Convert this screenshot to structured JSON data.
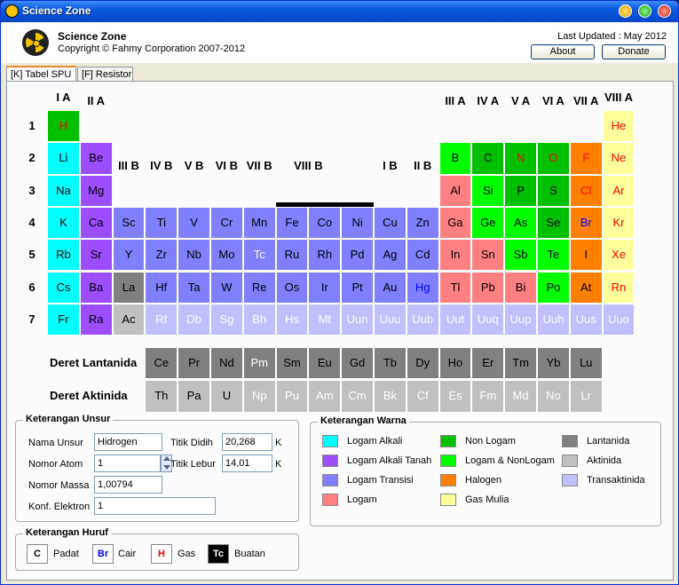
{
  "window": {
    "title": "Science Zone"
  },
  "header": {
    "app_name": "Science Zone",
    "copyright": "Copyright © Fahmy Corporation 2007-2012",
    "last_updated": "Last Updated : May 2012",
    "about_label": "About",
    "donate_label": "Donate"
  },
  "tabs": [
    {
      "label": "[K] Tabel SPU"
    },
    {
      "label": "[F] Resistor"
    }
  ],
  "table": {
    "group_labels": [
      "I A",
      "II A",
      "III B",
      "IV B",
      "V B",
      "VI B",
      "VII B",
      "VIII B",
      "I B",
      "II B",
      "III A",
      "IV A",
      "V A",
      "VI A",
      "VII A",
      "VIII A"
    ],
    "period_labels": [
      "1",
      "2",
      "3",
      "4",
      "5",
      "6",
      "7"
    ],
    "lanthanide_label": "Deret Lantanida",
    "actinide_label": "Deret Aktinida",
    "elements": [
      {
        "s": "H",
        "r": 1,
        "c": 1,
        "cat": "nonlogam",
        "st": "gas"
      },
      {
        "s": "He",
        "r": 1,
        "c": 18,
        "cat": "gas_mulia",
        "st": "gas"
      },
      {
        "s": "Li",
        "r": 2,
        "c": 1,
        "cat": "alkali",
        "st": "padat"
      },
      {
        "s": "Be",
        "r": 2,
        "c": 2,
        "cat": "alkali_tanah",
        "st": "padat"
      },
      {
        "s": "B",
        "r": 2,
        "c": 13,
        "cat": "logam_nonlogam",
        "st": "padat"
      },
      {
        "s": "C",
        "r": 2,
        "c": 14,
        "cat": "nonlogam",
        "st": "padat"
      },
      {
        "s": "N",
        "r": 2,
        "c": 15,
        "cat": "nonlogam",
        "st": "gas"
      },
      {
        "s": "O",
        "r": 2,
        "c": 16,
        "cat": "nonlogam",
        "st": "gas"
      },
      {
        "s": "F",
        "r": 2,
        "c": 17,
        "cat": "halogen",
        "st": "gas"
      },
      {
        "s": "Ne",
        "r": 2,
        "c": 18,
        "cat": "gas_mulia",
        "st": "gas"
      },
      {
        "s": "Na",
        "r": 3,
        "c": 1,
        "cat": "alkali",
        "st": "padat"
      },
      {
        "s": "Mg",
        "r": 3,
        "c": 2,
        "cat": "alkali_tanah",
        "st": "padat"
      },
      {
        "s": "Al",
        "r": 3,
        "c": 13,
        "cat": "logam",
        "st": "padat"
      },
      {
        "s": "Si",
        "r": 3,
        "c": 14,
        "cat": "logam_nonlogam",
        "st": "padat"
      },
      {
        "s": "P",
        "r": 3,
        "c": 15,
        "cat": "nonlogam",
        "st": "padat"
      },
      {
        "s": "S",
        "r": 3,
        "c": 16,
        "cat": "nonlogam",
        "st": "padat"
      },
      {
        "s": "Cl",
        "r": 3,
        "c": 17,
        "cat": "halogen",
        "st": "gas"
      },
      {
        "s": "Ar",
        "r": 3,
        "c": 18,
        "cat": "gas_mulia",
        "st": "gas"
      },
      {
        "s": "K",
        "r": 4,
        "c": 1,
        "cat": "alkali",
        "st": "padat"
      },
      {
        "s": "Ca",
        "r": 4,
        "c": 2,
        "cat": "alkali_tanah",
        "st": "padat"
      },
      {
        "s": "Sc",
        "r": 4,
        "c": 3,
        "cat": "transisi",
        "st": "padat"
      },
      {
        "s": "Ti",
        "r": 4,
        "c": 4,
        "cat": "transisi",
        "st": "padat"
      },
      {
        "s": "V",
        "r": 4,
        "c": 5,
        "cat": "transisi",
        "st": "padat"
      },
      {
        "s": "Cr",
        "r": 4,
        "c": 6,
        "cat": "transisi",
        "st": "padat"
      },
      {
        "s": "Mn",
        "r": 4,
        "c": 7,
        "cat": "transisi",
        "st": "padat"
      },
      {
        "s": "Fe",
        "r": 4,
        "c": 8,
        "cat": "transisi",
        "st": "padat"
      },
      {
        "s": "Co",
        "r": 4,
        "c": 9,
        "cat": "transisi",
        "st": "padat"
      },
      {
        "s": "Ni",
        "r": 4,
        "c": 10,
        "cat": "transisi",
        "st": "padat"
      },
      {
        "s": "Cu",
        "r": 4,
        "c": 11,
        "cat": "transisi",
        "st": "padat"
      },
      {
        "s": "Zn",
        "r": 4,
        "c": 12,
        "cat": "transisi",
        "st": "padat"
      },
      {
        "s": "Ga",
        "r": 4,
        "c": 13,
        "cat": "logam",
        "st": "padat"
      },
      {
        "s": "Ge",
        "r": 4,
        "c": 14,
        "cat": "logam_nonlogam",
        "st": "padat"
      },
      {
        "s": "As",
        "r": 4,
        "c": 15,
        "cat": "logam_nonlogam",
        "st": "padat"
      },
      {
        "s": "Se",
        "r": 4,
        "c": 16,
        "cat": "nonlogam",
        "st": "padat"
      },
      {
        "s": "Br",
        "r": 4,
        "c": 17,
        "cat": "halogen",
        "st": "cair"
      },
      {
        "s": "Kr",
        "r": 4,
        "c": 18,
        "cat": "gas_mulia",
        "st": "gas"
      },
      {
        "s": "Rb",
        "r": 5,
        "c": 1,
        "cat": "alkali",
        "st": "padat"
      },
      {
        "s": "Sr",
        "r": 5,
        "c": 2,
        "cat": "alkali_tanah",
        "st": "padat"
      },
      {
        "s": "Y",
        "r": 5,
        "c": 3,
        "cat": "transisi",
        "st": "padat"
      },
      {
        "s": "Zr",
        "r": 5,
        "c": 4,
        "cat": "transisi",
        "st": "padat"
      },
      {
        "s": "Nb",
        "r": 5,
        "c": 5,
        "cat": "transisi",
        "st": "padat"
      },
      {
        "s": "Mo",
        "r": 5,
        "c": 6,
        "cat": "transisi",
        "st": "padat"
      },
      {
        "s": "Tc",
        "r": 5,
        "c": 7,
        "cat": "transisi",
        "st": "buatan"
      },
      {
        "s": "Ru",
        "r": 5,
        "c": 8,
        "cat": "transisi",
        "st": "padat"
      },
      {
        "s": "Rh",
        "r": 5,
        "c": 9,
        "cat": "transisi",
        "st": "padat"
      },
      {
        "s": "Pd",
        "r": 5,
        "c": 10,
        "cat": "transisi",
        "st": "padat"
      },
      {
        "s": "Ag",
        "r": 5,
        "c": 11,
        "cat": "transisi",
        "st": "padat"
      },
      {
        "s": "Cd",
        "r": 5,
        "c": 12,
        "cat": "transisi",
        "st": "padat"
      },
      {
        "s": "In",
        "r": 5,
        "c": 13,
        "cat": "logam",
        "st": "padat"
      },
      {
        "s": "Sn",
        "r": 5,
        "c": 14,
        "cat": "logam",
        "st": "padat"
      },
      {
        "s": "Sb",
        "r": 5,
        "c": 15,
        "cat": "logam_nonlogam",
        "st": "padat"
      },
      {
        "s": "Te",
        "r": 5,
        "c": 16,
        "cat": "logam_nonlogam",
        "st": "padat"
      },
      {
        "s": "I",
        "r": 5,
        "c": 17,
        "cat": "halogen",
        "st": "padat"
      },
      {
        "s": "Xe",
        "r": 5,
        "c": 18,
        "cat": "gas_mulia",
        "st": "gas"
      },
      {
        "s": "Cs",
        "r": 6,
        "c": 1,
        "cat": "alkali",
        "st": "padat"
      },
      {
        "s": "Ba",
        "r": 6,
        "c": 2,
        "cat": "alkali_tanah",
        "st": "padat"
      },
      {
        "s": "La",
        "r": 6,
        "c": 3,
        "cat": "lantanida",
        "st": "padat"
      },
      {
        "s": "Hf",
        "r": 6,
        "c": 4,
        "cat": "transisi",
        "st": "padat"
      },
      {
        "s": "Ta",
        "r": 6,
        "c": 5,
        "cat": "transisi",
        "st": "padat"
      },
      {
        "s": "W",
        "r": 6,
        "c": 6,
        "cat": "transisi",
        "st": "padat"
      },
      {
        "s": "Re",
        "r": 6,
        "c": 7,
        "cat": "transisi",
        "st": "padat"
      },
      {
        "s": "Os",
        "r": 6,
        "c": 8,
        "cat": "transisi",
        "st": "padat"
      },
      {
        "s": "Ir",
        "r": 6,
        "c": 9,
        "cat": "transisi",
        "st": "padat"
      },
      {
        "s": "Pt",
        "r": 6,
        "c": 10,
        "cat": "transisi",
        "st": "padat"
      },
      {
        "s": "Au",
        "r": 6,
        "c": 11,
        "cat": "transisi",
        "st": "padat"
      },
      {
        "s": "Hg",
        "r": 6,
        "c": 12,
        "cat": "transisi",
        "st": "cair"
      },
      {
        "s": "Tl",
        "r": 6,
        "c": 13,
        "cat": "logam",
        "st": "padat"
      },
      {
        "s": "Pb",
        "r": 6,
        "c": 14,
        "cat": "logam",
        "st": "padat"
      },
      {
        "s": "Bi",
        "r": 6,
        "c": 15,
        "cat": "logam",
        "st": "padat"
      },
      {
        "s": "Po",
        "r": 6,
        "c": 16,
        "cat": "logam_nonlogam",
        "st": "padat"
      },
      {
        "s": "At",
        "r": 6,
        "c": 17,
        "cat": "halogen",
        "st": "padat"
      },
      {
        "s": "Rn",
        "r": 6,
        "c": 18,
        "cat": "gas_mulia",
        "st": "gas"
      },
      {
        "s": "Fr",
        "r": 7,
        "c": 1,
        "cat": "alkali",
        "st": "padat"
      },
      {
        "s": "Ra",
        "r": 7,
        "c": 2,
        "cat": "alkali_tanah",
        "st": "padat"
      },
      {
        "s": "Ac",
        "r": 7,
        "c": 3,
        "cat": "aktinida",
        "st": "padat"
      },
      {
        "s": "Rf",
        "r": 7,
        "c": 4,
        "cat": "transaktinida",
        "st": "buatan"
      },
      {
        "s": "Db",
        "r": 7,
        "c": 5,
        "cat": "transaktinida",
        "st": "buatan"
      },
      {
        "s": "Sg",
        "r": 7,
        "c": 6,
        "cat": "transaktinida",
        "st": "buatan"
      },
      {
        "s": "Bh",
        "r": 7,
        "c": 7,
        "cat": "transaktinida",
        "st": "buatan"
      },
      {
        "s": "Hs",
        "r": 7,
        "c": 8,
        "cat": "transaktinida",
        "st": "buatan"
      },
      {
        "s": "Mt",
        "r": 7,
        "c": 9,
        "cat": "transaktinida",
        "st": "buatan"
      },
      {
        "s": "Uun",
        "r": 7,
        "c": 10,
        "cat": "transaktinida",
        "st": "buatan"
      },
      {
        "s": "Uuu",
        "r": 7,
        "c": 11,
        "cat": "transaktinida",
        "st": "buatan"
      },
      {
        "s": "Uub",
        "r": 7,
        "c": 12,
        "cat": "transaktinida",
        "st": "buatan"
      },
      {
        "s": "Uut",
        "r": 7,
        "c": 13,
        "cat": "transaktinida",
        "st": "buatan"
      },
      {
        "s": "Uuq",
        "r": 7,
        "c": 14,
        "cat": "transaktinida",
        "st": "buatan"
      },
      {
        "s": "Uup",
        "r": 7,
        "c": 15,
        "cat": "transaktinida",
        "st": "buatan"
      },
      {
        "s": "Uuh",
        "r": 7,
        "c": 16,
        "cat": "transaktinida",
        "st": "buatan"
      },
      {
        "s": "Uus",
        "r": 7,
        "c": 17,
        "cat": "transaktinida",
        "st": "buatan"
      },
      {
        "s": "Uuo",
        "r": 7,
        "c": 18,
        "cat": "transaktinida",
        "st": "buatan"
      }
    ],
    "lanthanides": [
      {
        "s": "Ce",
        "st": "padat"
      },
      {
        "s": "Pr",
        "st": "padat"
      },
      {
        "s": "Nd",
        "st": "padat"
      },
      {
        "s": "Pm",
        "st": "buatan"
      },
      {
        "s": "Sm",
        "st": "padat"
      },
      {
        "s": "Eu",
        "st": "padat"
      },
      {
        "s": "Gd",
        "st": "padat"
      },
      {
        "s": "Tb",
        "st": "padat"
      },
      {
        "s": "Dy",
        "st": "padat"
      },
      {
        "s": "Ho",
        "st": "padat"
      },
      {
        "s": "Er",
        "st": "padat"
      },
      {
        "s": "Tm",
        "st": "padat"
      },
      {
        "s": "Yb",
        "st": "padat"
      },
      {
        "s": "Lu",
        "st": "padat"
      }
    ],
    "actinides": [
      {
        "s": "Th",
        "st": "padat"
      },
      {
        "s": "Pa",
        "st": "padat"
      },
      {
        "s": "U",
        "st": "padat"
      },
      {
        "s": "Np",
        "st": "buatan"
      },
      {
        "s": "Pu",
        "st": "buatan"
      },
      {
        "s": "Am",
        "st": "buatan"
      },
      {
        "s": "Cm",
        "st": "buatan"
      },
      {
        "s": "Bk",
        "st": "buatan"
      },
      {
        "s": "Cf",
        "st": "buatan"
      },
      {
        "s": "Es",
        "st": "buatan"
      },
      {
        "s": "Fm",
        "st": "buatan"
      },
      {
        "s": "Md",
        "st": "buatan"
      },
      {
        "s": "No",
        "st": "buatan"
      },
      {
        "s": "Lr",
        "st": "buatan"
      }
    ]
  },
  "colors": {
    "alkali": "#00ffff",
    "alkali_tanah": "#9b4dff",
    "transisi": "#8080ff",
    "logam": "#ff8080",
    "nonlogam": "#00c000",
    "logam_nonlogam": "#00ff00",
    "halogen": "#ff8000",
    "gas_mulia": "#ffff9b",
    "lantanida": "#808080",
    "aktinida": "#c0c0c0",
    "transaktinida": "#c0c0ff",
    "text_padat": "#000000",
    "text_cair": "#0000ff",
    "text_gas": "#ff0000",
    "text_buatan": "#ffffff"
  },
  "unsur": {
    "legend": "Keterangan Unsur",
    "nama_label": "Nama Unsur",
    "nama_value": "Hidrogen",
    "atom_label": "Nomor Atom",
    "atom_value": "1",
    "massa_label": "Nomor Massa",
    "massa_value": "1,00794",
    "konf_label": "Konf. Elektron",
    "konf_value": "1",
    "didih_label": "Titik Didih",
    "didih_value": "20,268",
    "didih_unit": "K",
    "lebur_label": "Titik Lebur",
    "lebur_value": "14,01",
    "lebur_unit": "K"
  },
  "huruf": {
    "legend": "Keterangan Huruf",
    "items": [
      {
        "sym": "C",
        "label": "Padat"
      },
      {
        "sym": "Br",
        "label": "Cair"
      },
      {
        "sym": "H",
        "label": "Gas"
      },
      {
        "sym": "Tc",
        "label": "Buatan"
      }
    ]
  },
  "warna": {
    "legend": "Keterangan Warna",
    "items": [
      {
        "key": "alkali",
        "label": "Logam Alkali"
      },
      {
        "key": "alkali_tanah",
        "label": "Logam Alkali Tanah"
      },
      {
        "key": "transisi",
        "label": "Logam Transisi"
      },
      {
        "key": "logam",
        "label": "Logam"
      },
      {
        "key": "nonlogam",
        "label": "Non Logam"
      },
      {
        "key": "logam_nonlogam",
        "label": "Logam & NonLogam"
      },
      {
        "key": "halogen",
        "label": "Halogen"
      },
      {
        "key": "gas_mulia",
        "label": "Gas Mulia"
      },
      {
        "key": "lantanida",
        "label": "Lantanida"
      },
      {
        "key": "aktinida",
        "label": "Aktinida"
      },
      {
        "key": "transaktinida",
        "label": "Transaktinida"
      }
    ]
  }
}
